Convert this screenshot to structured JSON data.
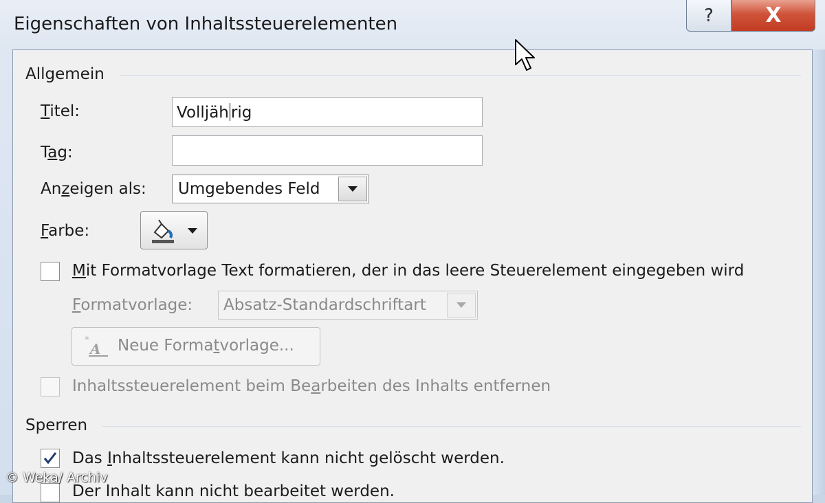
{
  "window": {
    "title": "Eigenschaften von Inhaltssteuerelementen",
    "help_glyph": "?",
    "close_glyph": "X",
    "colors": {
      "close": "#c8442a",
      "frame": "#dfe7f2",
      "content": "#f0f0f0"
    }
  },
  "allgemein": {
    "group_label": "Allgemein",
    "titel": {
      "label_ul": "T",
      "label_rest": "itel:",
      "value_before_caret": "Volljäh",
      "value_after_caret": "rig"
    },
    "tag": {
      "label_pre": "T",
      "label_ul": "a",
      "label_post": "g:",
      "value": ""
    },
    "anzeigen": {
      "label_pre": "An",
      "label_ul": "z",
      "label_post": "eigen als:",
      "value": "Umgebendes Feld"
    },
    "farbe": {
      "label_ul": "F",
      "label_rest": "arbe:",
      "icon": "paint-bucket-icon"
    },
    "mit_formatvorlage": {
      "checked": false,
      "label_ul": "M",
      "label_rest": "it Formatvorlage Text formatieren, der in das leere Steuerelement eingegeben wird"
    },
    "formatvorlage": {
      "label_ul": "F",
      "label_rest": "ormatvorlage:",
      "value": "Absatz-Standardschriftart"
    },
    "neue_formatvorlage": {
      "label_pre": "Neue Forma",
      "label_ul": "t",
      "label_post": "vorlage..."
    },
    "entfernen": {
      "checked": false,
      "label_pre": "Inhaltssteuerelement beim Be",
      "label_ul": "a",
      "label_post": "rbeiten des Inhalts entfernen"
    }
  },
  "sperren": {
    "group_label": "Sperren",
    "nicht_geloescht": {
      "checked": true,
      "label_pre": "Das ",
      "label_ul": "I",
      "label_post": "nhaltssteuerelement kann nicht gelöscht werden."
    },
    "nicht_bearbeitet": {
      "checked": false,
      "label": "Der Inhalt kann nicht bearbeitet werden."
    }
  },
  "watermark": "© Weka/ Archiv"
}
